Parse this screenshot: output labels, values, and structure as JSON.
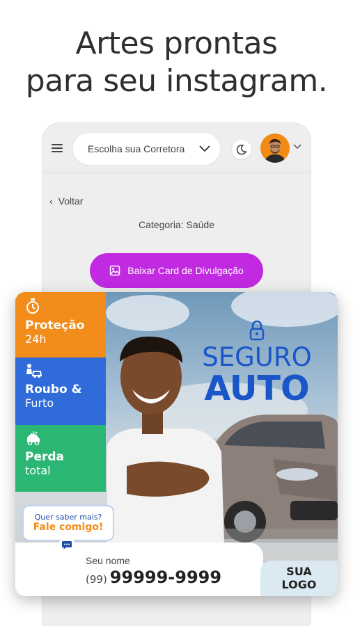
{
  "headline": {
    "line1": "Artes prontas",
    "line2": "para seu instagram."
  },
  "app": {
    "menu_icon": "hamburger-icon",
    "select": {
      "value": "Escolha sua Corretora",
      "icon": "chevron-down-icon"
    },
    "theme_icon": "moon-icon",
    "back_label": "Voltar",
    "category": "Categoria: Saúde",
    "download_button": "Baixar Card de Divulgação"
  },
  "card": {
    "features": [
      {
        "line1": "Proteção",
        "line2": "24h",
        "icon": "stopwatch-icon",
        "color": "#f28c1a"
      },
      {
        "line1": "Roubo &",
        "line2": "Furto",
        "icon": "thief-car-icon",
        "color": "#2f6cd9"
      },
      {
        "line1": "Perda",
        "line2": "total",
        "icon": "crashed-car-icon",
        "color": "#2bb673"
      }
    ],
    "brand": {
      "word1": "SEGURO",
      "word2": "AUTO",
      "color": "#1b56c9"
    },
    "bubble": {
      "line1": "Quer saber mais?",
      "line2": "Fale comigo!"
    },
    "contact": {
      "name_label": "Seu nome",
      "area_code": "(99)",
      "phone": "99999-9999"
    },
    "logo_badge": {
      "line1": "SUA",
      "line2": "LOGO"
    }
  },
  "colors": {
    "accent_button": "#c12ae0"
  }
}
